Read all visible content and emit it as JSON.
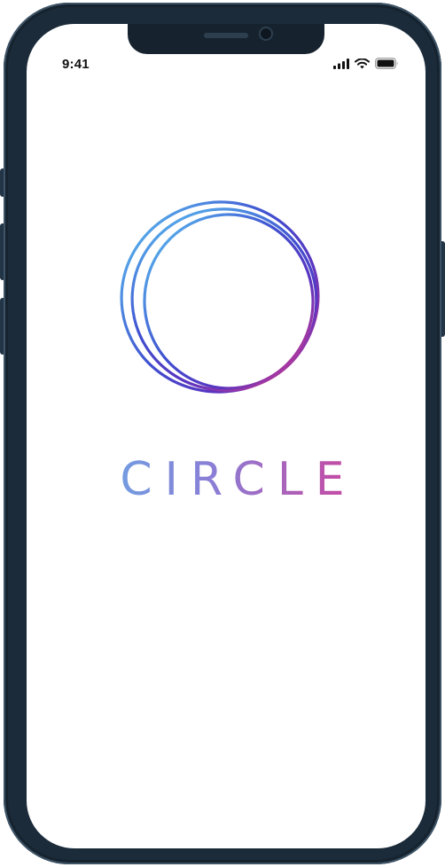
{
  "status_bar": {
    "time": "9:41",
    "icons": [
      "signal-icon",
      "wifi-icon",
      "battery-icon"
    ]
  },
  "splash": {
    "logo_icon": "circle-logo-icon",
    "brand_name": "CIRCLE"
  },
  "colors": {
    "gradient_start": "#5cb8ea",
    "gradient_mid": "#5b3fc4",
    "gradient_end": "#e03a83",
    "frame": "#1b2b3a",
    "screen": "#ffffff"
  }
}
